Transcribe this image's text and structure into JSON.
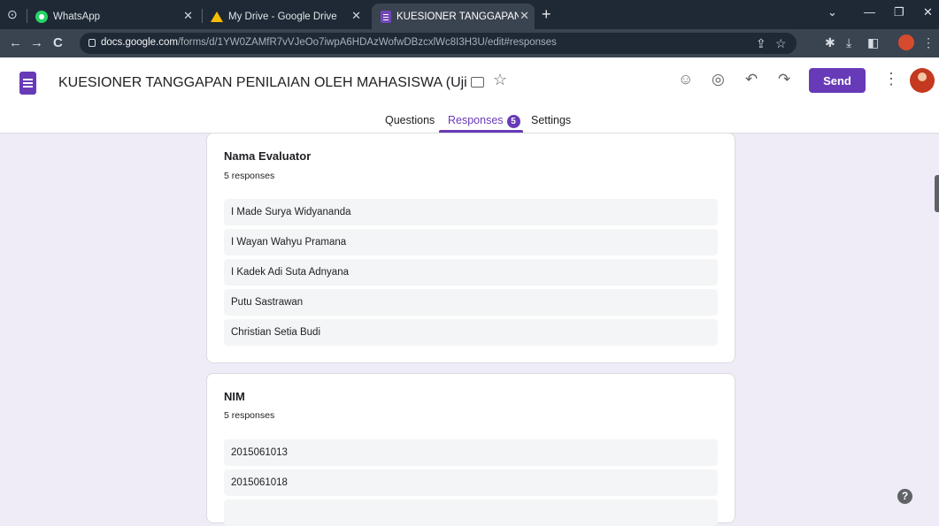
{
  "browser": {
    "tabs": [
      {
        "title": "WhatsApp",
        "icon": "whatsapp-icon"
      },
      {
        "title": "My Drive - Google Drive",
        "icon": "google-drive-icon"
      },
      {
        "title": "KUESIONER TANGGAPAN PENILA",
        "icon": "google-forms-icon"
      }
    ],
    "url_host": "docs.google.com",
    "url_path": "/forms/d/1YW0ZAMfR7vVJeOo7iwpA6HDAzWofwDBzcxlWc8I3H3U/edit#responses"
  },
  "form": {
    "title": "KUESIONER TANGGAPAN PENILAIAN OLEH MAHASISWA (Uji Coba Kelom",
    "send_label": "Send",
    "tabs": {
      "questions": "Questions",
      "responses": "Responses",
      "responses_count": "5",
      "settings": "Settings"
    }
  },
  "questions": [
    {
      "title": "Nama Evaluator",
      "count": "5 responses",
      "responses": [
        "I Made Surya Widyananda",
        "I Wayan Wahyu Pramana",
        "I Kadek Adi Suta Adnyana",
        "Putu Sastrawan",
        "Christian Setia Budi"
      ]
    },
    {
      "title": "NIM",
      "count": "5 responses",
      "responses": [
        "2015061013",
        "2015061018"
      ]
    }
  ],
  "colors": {
    "accent": "#673ab7",
    "page_background": "#efebf7"
  }
}
